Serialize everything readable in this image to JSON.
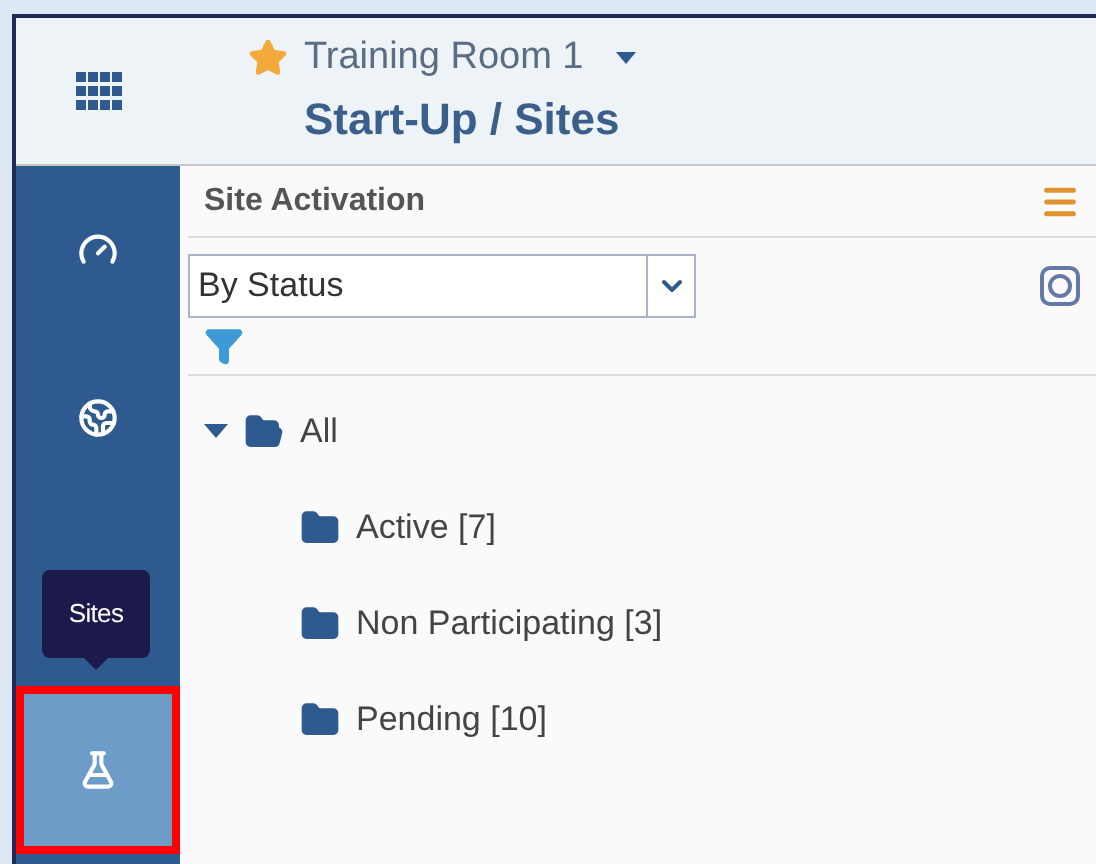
{
  "header": {
    "favorite": true,
    "room": "Training Room 1",
    "title": "Start-Up / Sites"
  },
  "sidebar": {
    "items": [
      {
        "kind": "gauge",
        "selected": false,
        "highlighted": false
      },
      {
        "kind": "globe",
        "selected": false,
        "highlighted": false
      },
      {
        "kind": "flask",
        "selected": true,
        "highlighted": true
      }
    ],
    "tooltip": "Sites"
  },
  "panel": {
    "title": "Site Activation",
    "select": {
      "value": "By Status"
    },
    "tree": [
      {
        "label": "All",
        "expanded": true,
        "children": [
          {
            "label": "Active [7]"
          },
          {
            "label": "Non Participating [3]"
          },
          {
            "label": "Pending [10]"
          }
        ]
      }
    ]
  }
}
